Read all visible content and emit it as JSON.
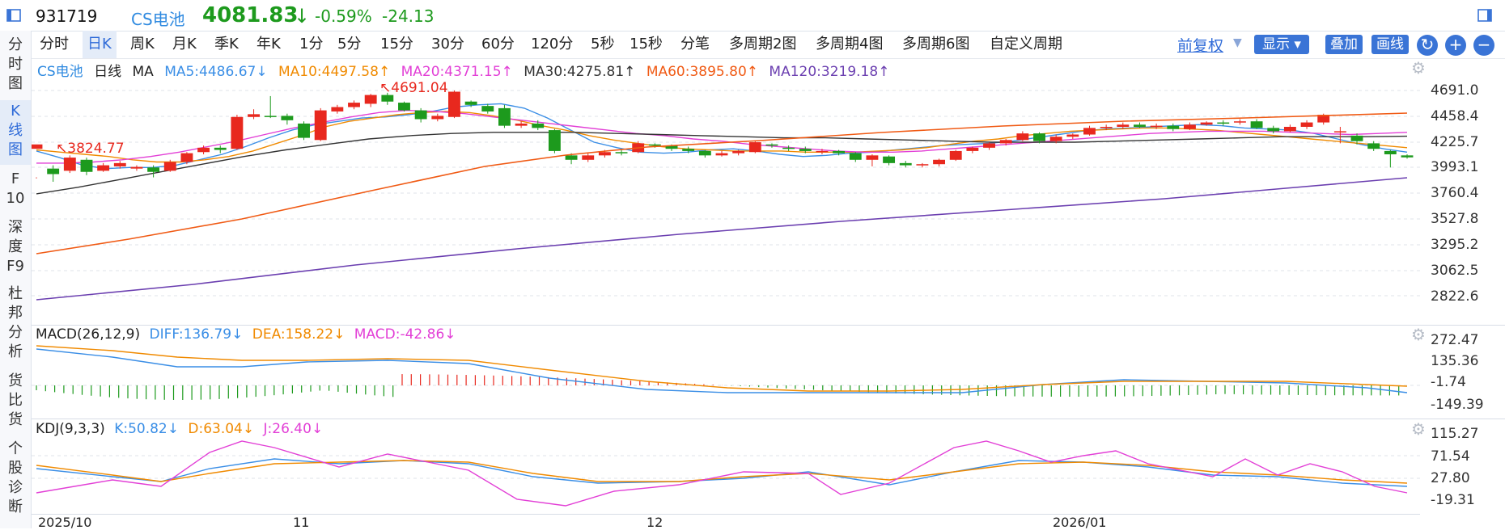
{
  "top": {
    "code": "931719",
    "name": "CS电池",
    "price": "4081.83",
    "arrow": "↓",
    "pct": "-0.59%",
    "change": "-24.13"
  },
  "left_tabs": [
    "分\n时\n图",
    "K\n线\n图",
    "F\n10",
    "深\n度\nF9",
    "杜\n邦\n分\n析",
    "货\n比\n货",
    "个\n股\n诊\n断"
  ],
  "periods": [
    "分时",
    "日K",
    "周K",
    "月K",
    "季K",
    "年K",
    "1分",
    "5分",
    "15分",
    "30分",
    "60分",
    "120分",
    "5秒",
    "15秒",
    "分笔",
    "多周期2图",
    "多周期4图",
    "多周期6图",
    "自定义周期"
  ],
  "toolbar": {
    "adjust": "前复权",
    "display": "显示",
    "overlay": "叠加",
    "draw": "画线"
  },
  "main_legend": {
    "name": "CS电池",
    "period": "日线",
    "ma": "MA",
    "ma5": "MA5:4486.67↓",
    "ma10": "MA10:4497.58↑",
    "ma20": "MA20:4371.15↑",
    "ma30": "MA30:4275.81↑",
    "ma60": "MA60:3895.80↑",
    "ma120": "MA120:3219.18↑"
  },
  "main_axis": [
    "4691.0",
    "4458.4",
    "4225.7",
    "3993.1",
    "3760.4",
    "3527.8",
    "3295.2",
    "3062.5",
    "2822.6"
  ],
  "annotations": {
    "high": "4691.04",
    "low": "3824.77"
  },
  "macd_legend": {
    "title": "MACD(26,12,9)",
    "diff": "DIFF:136.79↓",
    "dea": "DEA:158.22↓",
    "macd": "MACD:-42.86↓"
  },
  "macd_axis": [
    "272.47",
    "135.36",
    "-1.74",
    "-149.39"
  ],
  "kdj_legend": {
    "title": "KDJ(9,3,3)",
    "k": "K:50.82↓",
    "d": "D:63.04↓",
    "j": "J:26.40↓"
  },
  "kdj_axis": [
    "115.27",
    "71.54",
    "27.80",
    "-19.31"
  ],
  "dates": [
    "2025/10",
    "11",
    "12",
    "2026/01"
  ],
  "colors": {
    "up": "#e8281e",
    "down": "#1d9a1d",
    "ma5": "#3a8ee6",
    "ma10": "#f08a00",
    "ma20": "#e23fd6",
    "ma30": "#333333",
    "ma60": "#f05a14",
    "ma120": "#6b3fb0",
    "accent": "#2f6bd8"
  },
  "chart_data": {
    "type": "candlestick",
    "price_range": [
      2822.6,
      4691.0
    ],
    "candles": [
      [
        4160,
        4200,
        3900,
        3890
      ],
      [
        3980,
        3930,
        4010,
        3860
      ],
      [
        3960,
        4080,
        4100,
        3940
      ],
      [
        4060,
        3950,
        4080,
        3920
      ],
      [
        3960,
        4010,
        4030,
        3950
      ],
      [
        4000,
        4030,
        4050,
        3980
      ],
      [
        3980,
        3995,
        4010,
        3960
      ],
      [
        3990,
        3950,
        4010,
        3900
      ],
      [
        3960,
        4040,
        4060,
        3950
      ],
      [
        4040,
        4120,
        4130,
        4020
      ],
      [
        4130,
        4170,
        4190,
        4110
      ],
      [
        4170,
        4150,
        4190,
        4120
      ],
      [
        4160,
        4450,
        4470,
        4150
      ],
      [
        4450,
        4475,
        4520,
        4430
      ],
      [
        4460,
        4455,
        4640,
        4440
      ],
      [
        4460,
        4420,
        4480,
        4380
      ],
      [
        4390,
        4260,
        4410,
        4240
      ],
      [
        4240,
        4510,
        4530,
        4230
      ],
      [
        4500,
        4540,
        4560,
        4480
      ],
      [
        4540,
        4580,
        4600,
        4520
      ],
      [
        4570,
        4650,
        4660,
        4540
      ],
      [
        4650,
        4590,
        4670,
        4560
      ],
      [
        4580,
        4510,
        4590,
        4500
      ],
      [
        4510,
        4430,
        4530,
        4400
      ],
      [
        4430,
        4460,
        4480,
        4410
      ],
      [
        4450,
        4680,
        4691,
        4440
      ],
      [
        4590,
        4560,
        4600,
        4540
      ],
      [
        4550,
        4500,
        4570,
        4480
      ],
      [
        4530,
        4370,
        4560,
        4350
      ],
      [
        4370,
        4390,
        4410,
        4350
      ],
      [
        4390,
        4350,
        4420,
        4330
      ],
      [
        4330,
        4140,
        4340,
        4120
      ],
      [
        4100,
        4060,
        4120,
        4020
      ],
      [
        4060,
        4100,
        4120,
        4040
      ],
      [
        4100,
        4130,
        4150,
        4080
      ],
      [
        4130,
        4120,
        4160,
        4100
      ],
      [
        4130,
        4210,
        4230,
        4120
      ],
      [
        4200,
        4190,
        4210,
        4170
      ],
      [
        4190,
        4160,
        4200,
        4140
      ],
      [
        4160,
        4140,
        4180,
        4120
      ],
      [
        4140,
        4100,
        4150,
        4080
      ],
      [
        4100,
        4120,
        4140,
        4090
      ],
      [
        4120,
        4140,
        4150,
        4100
      ],
      [
        4130,
        4220,
        4230,
        4120
      ],
      [
        4200,
        4190,
        4210,
        4170
      ],
      [
        4170,
        4160,
        4190,
        4140
      ],
      [
        4160,
        4140,
        4180,
        4120
      ],
      [
        4140,
        4140,
        4160,
        4110
      ],
      [
        4140,
        4120,
        4150,
        4100
      ],
      [
        4120,
        4060,
        4130,
        4040
      ],
      [
        4060,
        4100,
        4110,
        4000
      ],
      [
        4090,
        4030,
        4100,
        4010
      ],
      [
        4030,
        4010,
        4050,
        3990
      ],
      [
        4010,
        4020,
        4030,
        3990
      ],
      [
        4020,
        4060,
        4070,
        4000
      ],
      [
        4060,
        4140,
        4150,
        4050
      ],
      [
        4140,
        4170,
        4180,
        4120
      ],
      [
        4170,
        4210,
        4220,
        4150
      ],
      [
        4210,
        4240,
        4250,
        4190
      ],
      [
        4240,
        4300,
        4320,
        4230
      ],
      [
        4300,
        4230,
        4310,
        4210
      ],
      [
        4230,
        4270,
        4290,
        4210
      ],
      [
        4270,
        4290,
        4300,
        4250
      ],
      [
        4290,
        4350,
        4370,
        4280
      ],
      [
        4350,
        4360,
        4380,
        4330
      ],
      [
        4360,
        4380,
        4400,
        4340
      ],
      [
        4380,
        4360,
        4400,
        4350
      ],
      [
        4360,
        4370,
        4390,
        4340
      ],
      [
        4370,
        4340,
        4390,
        4320
      ],
      [
        4340,
        4380,
        4400,
        4330
      ],
      [
        4380,
        4400,
        4410,
        4370
      ],
      [
        4400,
        4390,
        4420,
        4370
      ],
      [
        4400,
        4410,
        4430,
        4380
      ],
      [
        4410,
        4350,
        4430,
        4340
      ],
      [
        4350,
        4320,
        4370,
        4300
      ],
      [
        4320,
        4360,
        4380,
        4310
      ],
      [
        4360,
        4400,
        4420,
        4340
      ],
      [
        4400,
        4470,
        4480,
        4380
      ],
      [
        4320,
        4320,
        4360,
        4210
      ],
      [
        4280,
        4230,
        4300,
        4200
      ],
      [
        4210,
        4160,
        4230,
        4140
      ],
      [
        4140,
        4110,
        4150,
        3990
      ],
      [
        4100,
        4082,
        4110,
        4070
      ]
    ],
    "ma_lines": {
      "ma5": [
        4140,
        4080,
        4010,
        3980,
        3990,
        3990,
        4010,
        4060,
        4110,
        4180,
        4260,
        4330,
        4380,
        4410,
        4440,
        4450,
        4470,
        4500,
        4540,
        4560,
        4570,
        4530,
        4440,
        4330,
        4220,
        4170,
        4130,
        4120,
        4130,
        4150,
        4160,
        4140,
        4110,
        4090,
        4100,
        4120,
        4130,
        4150,
        4170,
        4190,
        4200,
        4210,
        4230,
        4260,
        4290,
        4320,
        4340,
        4350,
        4360,
        4370,
        4380,
        4370,
        4350,
        4340,
        4330,
        4300,
        4250,
        4200,
        4160,
        4130
      ],
      "ma10": [
        4150,
        4130,
        4110,
        4090,
        4060,
        4040,
        4040,
        4060,
        4090,
        4140,
        4210,
        4280,
        4360,
        4410,
        4440,
        4470,
        4490,
        4500,
        4490,
        4460,
        4420,
        4370,
        4330,
        4280,
        4240,
        4210,
        4180,
        4160,
        4150,
        4140,
        4140,
        4140,
        4130,
        4130,
        4130,
        4140,
        4150,
        4170,
        4200,
        4230,
        4250,
        4280,
        4300,
        4320,
        4330,
        4340,
        4350,
        4350,
        4340,
        4330,
        4310,
        4290,
        4270,
        4250,
        4230,
        4210,
        4190,
        4170
      ],
      "ma20": [
        4030,
        4030,
        4040,
        4060,
        4090,
        4130,
        4180,
        4230,
        4290,
        4350,
        4400,
        4450,
        4490,
        4510,
        4500,
        4480,
        4450,
        4420,
        4390,
        4360,
        4330,
        4300,
        4280,
        4250,
        4230,
        4200,
        4180,
        4160,
        4140,
        4130,
        4130,
        4140,
        4160,
        4180,
        4200,
        4220,
        4240,
        4260,
        4280,
        4300,
        4310,
        4320,
        4320,
        4320,
        4310,
        4300,
        4290,
        4300,
        4310
      ],
      "ma30": [
        3750,
        3810,
        3880,
        3950,
        4020,
        4090,
        4150,
        4200,
        4250,
        4280,
        4300,
        4310,
        4310,
        4310,
        4300,
        4290,
        4280,
        4270,
        4260,
        4260,
        4250,
        4240,
        4230,
        4220,
        4220,
        4220,
        4230,
        4240,
        4250,
        4260,
        4270,
        4270,
        4270,
        4275
      ]
    }
  }
}
